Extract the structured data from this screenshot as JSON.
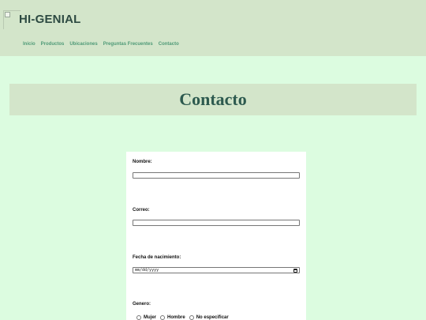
{
  "header": {
    "brand": "HI-GENIAL",
    "nav": [
      "Inicio",
      "Productos",
      "Ubicaciones",
      "Preguntas Frecuentes",
      "Contacto"
    ]
  },
  "banner": {
    "title": "Contacto"
  },
  "form": {
    "name_label": "Nombre:",
    "name_value": "",
    "email_label": "Correo:",
    "email_value": "",
    "birthdate_label": "Fecha de nacimiento:",
    "birthdate_placeholder": "mm/dd/yyyy",
    "gender_label": "Genero:",
    "gender_options": [
      "Mujer",
      "Hombre",
      "No especificar"
    ]
  },
  "colors": {
    "page_bg": "#dcfce0",
    "header_bg": "#d3e5ca",
    "brand_text": "#2d4a42",
    "nav_link": "#4f9a77",
    "title_text": "#2d5a4f"
  }
}
